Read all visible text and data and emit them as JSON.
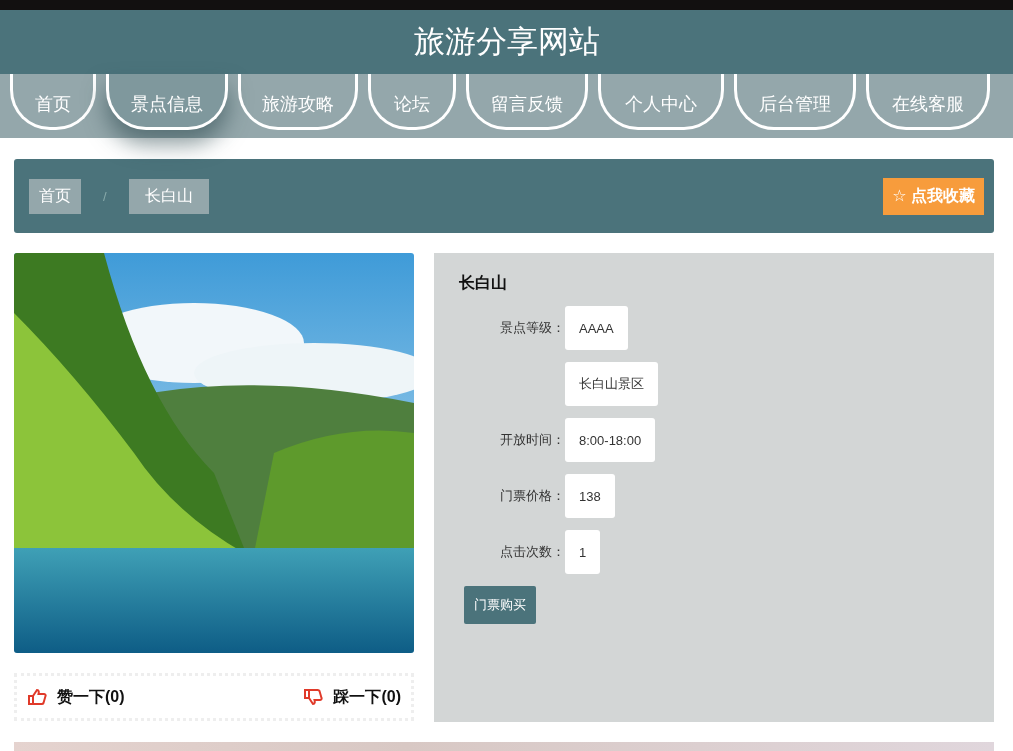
{
  "site": {
    "title": "旅游分享网站"
  },
  "nav": [
    {
      "label": "首页",
      "selected": false
    },
    {
      "label": "景点信息",
      "selected": true
    },
    {
      "label": "旅游攻略",
      "selected": false
    },
    {
      "label": "论坛",
      "selected": false
    },
    {
      "label": "留言反馈",
      "selected": false
    },
    {
      "label": "个人中心",
      "selected": false
    },
    {
      "label": "后台管理",
      "selected": false
    },
    {
      "label": "在线客服",
      "selected": false
    }
  ],
  "breadcrumb": [
    "首页",
    "长白山"
  ],
  "breadcrumb_separator": "/",
  "favorite_button": "☆ 点我收藏",
  "spot": {
    "name": "长白山",
    "fields": [
      {
        "label": "景点等级：",
        "value": "AAAA"
      },
      {
        "value": "长白山景区"
      },
      {
        "label": "开放时间：",
        "value": "8:00-18:00"
      },
      {
        "label": "门票价格：",
        "value": "138"
      },
      {
        "label": "点击次数：",
        "value": "1"
      }
    ],
    "buy_button": "门票购买"
  },
  "votes": {
    "like": "赞一下(0)",
    "dislike": "踩一下(0)"
  }
}
